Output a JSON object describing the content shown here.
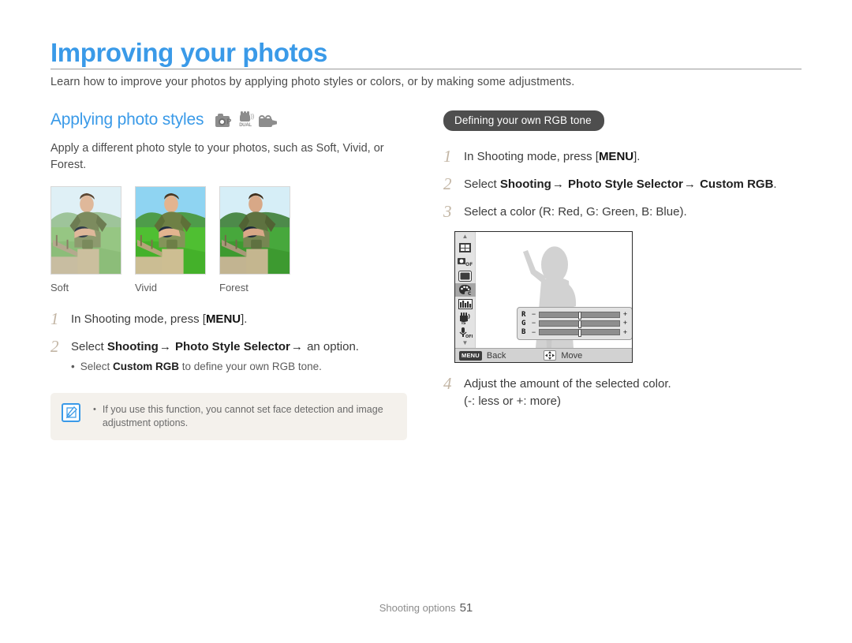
{
  "document": {
    "title": "Improving your photos",
    "intro": "Learn how to improve your photos by applying photo styles or colors, or by making some adjustments.",
    "footer_label": "Shooting options",
    "footer_page": "51",
    "accent_color": "#3a9ae8",
    "step_number_color": "#c3b6a5"
  },
  "left": {
    "section_title": "Applying photo styles",
    "mode_icons": [
      "camera-p-icon",
      "dual-is-icon",
      "movie-camera-icon"
    ],
    "body": "Apply a different photo style to your photos, such as Soft, Vivid, or Forest.",
    "thumbnails": [
      {
        "caption": "Soft",
        "sky": "#dff0f6",
        "hill": "#8fbf8a",
        "grass": "#8fc37a",
        "saturation": "soft"
      },
      {
        "caption": "Vivid",
        "sky": "#8fd4f2",
        "hill": "#4e9c4a",
        "grass": "#4fbf32",
        "saturation": "vivid"
      },
      {
        "caption": "Forest",
        "sky": "#d6eef7",
        "hill": "#4d8a4a",
        "grass": "#47a83c",
        "saturation": "forest"
      }
    ],
    "steps": [
      {
        "num": "1",
        "pre": "In Shooting mode, press [",
        "key": "MENU",
        "post": "]."
      },
      {
        "num": "2",
        "pre": "Select ",
        "b1": "Shooting",
        "arrow1": "→",
        "b2": "Photo Style Selector",
        "arrow2": "→",
        "post": "an option.",
        "bullet_pre": "Select ",
        "bullet_b": "Custom RGB",
        "bullet_post": " to define your own RGB tone."
      }
    ],
    "note": {
      "icon": "note-pen-icon",
      "bullet": "•",
      "text": "If you use this function, you cannot set face detection and image adjustment options."
    }
  },
  "right": {
    "pill_label": "Defining your own RGB tone",
    "steps": [
      {
        "num": "1",
        "pre": "In Shooting mode, press [",
        "key": "MENU",
        "post": "]."
      },
      {
        "num": "2",
        "pre": "Select ",
        "b1": "Shooting",
        "arrow1": "→",
        "b2": "Photo Style Selector",
        "arrow2": "→",
        "b3": "Custom RGB",
        "post": "."
      },
      {
        "num": "3",
        "text": "Select a color (R: Red, G: Green, B: Blue)."
      },
      {
        "num": "4",
        "text": "Adjust the amount of the selected color.",
        "sub": "(-: less or +: more)"
      }
    ],
    "lcd": {
      "sidebar_icons": [
        "chevron-up-icon",
        "face-detection-icon",
        "flash-off-icon",
        "screen-icon",
        "photo-style-palette-icon",
        "image-adjust-icon",
        "dual-is-hand-icon",
        "voice-off-icon",
        "chevron-down-icon"
      ],
      "selected_icon_index": 4,
      "rgb_rows": [
        {
          "label": "R",
          "minus": "−",
          "plus": "+",
          "value": 50
        },
        {
          "label": "G",
          "minus": "−",
          "plus": "+",
          "value": 50
        },
        {
          "label": "B",
          "minus": "−",
          "plus": "+",
          "value": 50
        }
      ],
      "bottom_bar": {
        "menu_badge": "MENU",
        "back_label": "Back",
        "nav_icon": "four-way-arrow-icon",
        "move_label": "Move"
      }
    }
  }
}
